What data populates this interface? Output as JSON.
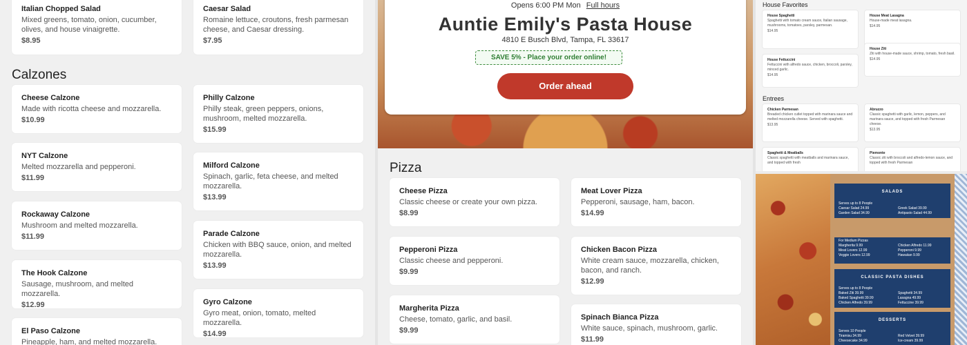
{
  "col1": {
    "salads": [
      {
        "name": "Italian Chopped Salad",
        "desc": "Mixed greens, tomato, onion, cucumber, olives, and house vinaigrette.",
        "price": "$8.95"
      },
      {
        "name": "Caesar Salad",
        "desc": "Romaine lettuce, croutons, fresh parmesan cheese, and Caesar dressing.",
        "price": "$7.95"
      }
    ],
    "calzones_title": "Calzones",
    "calzones_left": [
      {
        "name": "Cheese Calzone",
        "desc": "Made with ricotta cheese and mozzarella.",
        "price": "$10.99"
      },
      {
        "name": "NYT Calzone",
        "desc": "Melted mozzarella and pepperoni.",
        "price": "$11.99"
      },
      {
        "name": "Rockaway Calzone",
        "desc": "Mushroom and melted mozzarella.",
        "price": "$11.99"
      },
      {
        "name": "The Hook Calzone",
        "desc": "Sausage, mushroom, and melted mozzarella.",
        "price": "$12.99"
      },
      {
        "name": "El Paso Calzone",
        "desc": "Pineapple, ham, and melted mozzarella.",
        "price": ""
      }
    ],
    "calzones_right": [
      {
        "name": "Philly Calzone",
        "desc": "Philly steak, green peppers, onions, mushroom, melted mozzarella.",
        "price": "$15.99"
      },
      {
        "name": "Milford Calzone",
        "desc": "Spinach, garlic, feta cheese, and melted mozzarella.",
        "price": "$13.99"
      },
      {
        "name": "Parade Calzone",
        "desc": "Chicken with BBQ sauce, onion, and melted mozzarella.",
        "price": "$13.99"
      },
      {
        "name": "Gyro Calzone",
        "desc": "Gyro meat, onion, tomato, melted mozzarella.",
        "price": "$14.99"
      }
    ]
  },
  "hero": {
    "hours": "Opens 6:00 PM Mon",
    "full_hours": "Full hours",
    "name": "Auntie Emily's Pasta House",
    "address": "4810 E Busch Blvd, Tampa, FL 33617",
    "promo": "SAVE 5% - Place your order online!",
    "order_btn": "Order ahead"
  },
  "pizza": {
    "title": "Pizza",
    "left": [
      {
        "name": "Cheese Pizza",
        "desc": "Classic cheese or create your own pizza.",
        "price": "$8.99"
      },
      {
        "name": "Pepperoni Pizza",
        "desc": "Classic cheese and pepperoni.",
        "price": "$9.99"
      },
      {
        "name": "Margherita Pizza",
        "desc": "Cheese, tomato, garlic, and basil.",
        "price": "$9.99"
      }
    ],
    "right": [
      {
        "name": "Meat Lover Pizza",
        "desc": "Pepperoni, sausage, ham, bacon.",
        "price": "$14.99"
      },
      {
        "name": "Chicken Bacon Pizza",
        "desc": "White cream sauce, mozzarella, chicken, bacon, and ranch.",
        "price": "$12.99"
      },
      {
        "name": "Spinach Bianca Pizza",
        "desc": "White sauce, spinach, mushroom, garlic.",
        "price": "$11.99"
      }
    ]
  },
  "preview": {
    "house_title": "House Favorites",
    "house": [
      {
        "name": "House Spaghetti",
        "desc": "Spaghetti with tomato cream sauce, Italian sausage, mushrooms, tomatoes, parsley, parmesan.",
        "price": "$14.95"
      },
      {
        "name": "House Meat Lasagna",
        "desc": "House-made meat lasagna.",
        "price": "$14.95"
      },
      {
        "name": "House Fettuccini",
        "desc": "Fettuccini with alfredo sauce, chicken, broccoli, parsley, minced garlic.",
        "price": "$14.95"
      },
      {
        "name": "House Ziti",
        "desc": "Ziti with house-made sauce, shrimp, tomato, fresh basil.",
        "price": "$14.95"
      }
    ],
    "entrees_title": "Entrees",
    "entrees": [
      {
        "name": "Chicken Parmesan",
        "desc": "Breaded chicken cutlet topped with marinara sauce and melted mozzarella cheese. Served with spaghetti.",
        "price": "$13.95"
      },
      {
        "name": "Abruzzo",
        "desc": "Classic spaghetti with garlic, lemon, peppers, and marinara sauce, and topped with fresh Parmesan cheese.",
        "price": "$13.95"
      },
      {
        "name": "Spaghetti & Meatballs",
        "desc": "Classic spaghetti with meatballs and marinara sauce, and topped with fresh",
        "price": ""
      },
      {
        "name": "Piemonte",
        "desc": "Classic ziti with broccoli and alfredo-lemon sauce, and topped with fresh Parmesan",
        "price": ""
      }
    ]
  },
  "board": {
    "salads_head": "SALADS",
    "salads_left": [
      "Serves up to 8 People",
      "Caesar Salad        24.99",
      "Garden Salad        34.99"
    ],
    "salads_right": [
      "Greek Salad        39.99",
      "Antipasto Salad   44.99"
    ],
    "pizza_left": [
      "For Medium Pizzas",
      "Margherita          9.99",
      "Meat Lovers        12.99",
      "Veggie Lovers      12.99"
    ],
    "pizza_right": [
      "Chicken Alfredo    11.99",
      "Pepperoni            9.99",
      "Hawaiian            9.99"
    ],
    "pasta_head": "CLASSIC PASTA DISHES",
    "pasta_left": [
      "Serves up to 8 People",
      "Baked Ziti          39.99",
      "Baked Spaghetti    39.99",
      "Chicken Alfredo     39.99"
    ],
    "pasta_right": [
      "Spaghetti           34.99",
      "Lasagna             49.99",
      "Fettuccine          39.99"
    ],
    "desserts_head": "DESSERTS",
    "desserts_left": [
      "Serves 10 People",
      "Tiramisu            34.99",
      "Cheesecake         34.99"
    ],
    "desserts_right": [
      "Red Velvet          39.99",
      "Ice-cream           39.99"
    ]
  }
}
